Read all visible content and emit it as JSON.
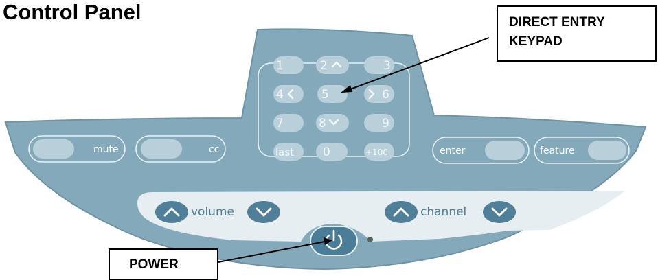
{
  "title": "Control Panel",
  "callouts": {
    "keypad_line1": "DIRECT ENTRY",
    "keypad_line2": "KEYPAD",
    "power": "POWER"
  },
  "keypad": {
    "keys": [
      "1",
      "2",
      "3",
      "4",
      "5",
      "6",
      "7",
      "8",
      "9",
      "last",
      "0",
      "+100"
    ]
  },
  "left_buttons": {
    "mute": "mute",
    "cc": "cc"
  },
  "right_buttons": {
    "enter": "enter",
    "feature": "feature"
  },
  "volume_label": "volume",
  "channel_label": "channel",
  "colors": {
    "panel": "#84a9bb",
    "panel_edge": "#6d93a6",
    "button": "#b9d0db",
    "outline": "#e9f1f5",
    "band": "#e6eef1",
    "arrow_button": "#4f7f99",
    "power_button": "#4a7d97",
    "led": "#56625e"
  },
  "icons": [
    "up-arrow-icon",
    "down-arrow-icon",
    "left-arrow-icon",
    "right-arrow-icon",
    "power-icon"
  ]
}
